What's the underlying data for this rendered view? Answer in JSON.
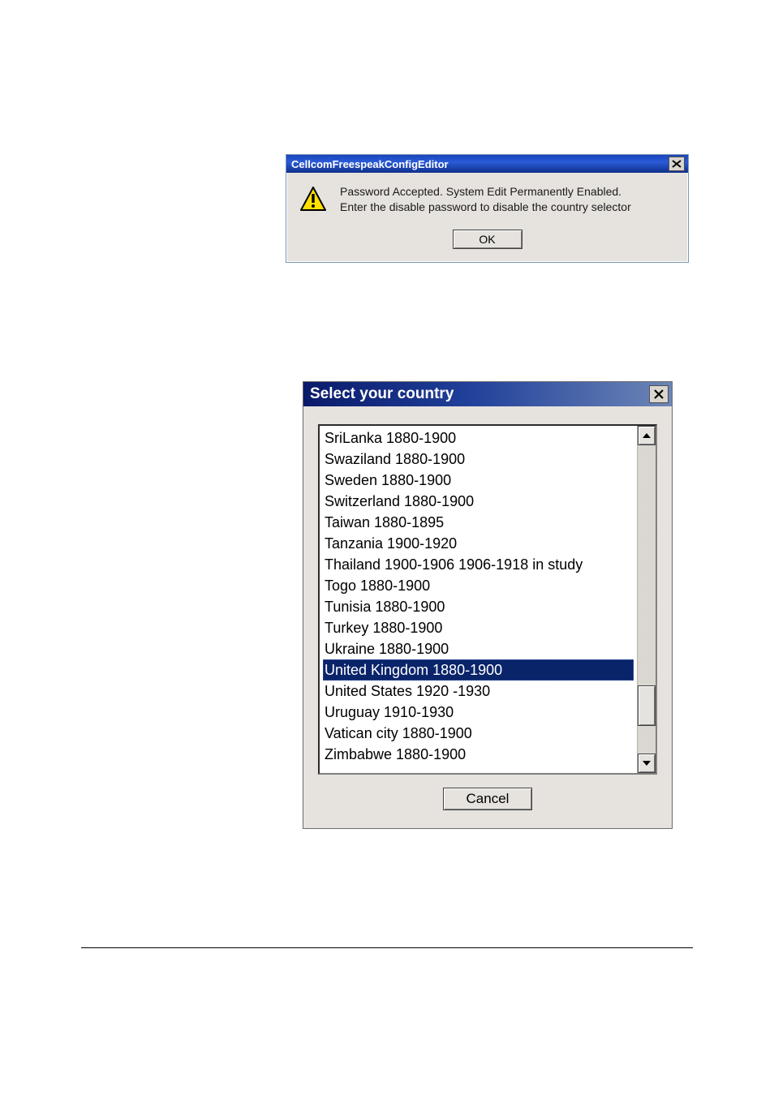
{
  "msg_dialog": {
    "title": "CellcomFreespeakConfigEditor",
    "line1": "Password Accepted. System Edit Permanently Enabled.",
    "line2": "Enter the disable password to disable the country selector",
    "ok_label": "OK"
  },
  "sel_dialog": {
    "title": "Select your country",
    "cancel_label": "Cancel",
    "selected_index": 11,
    "items": [
      "SriLanka 1880-1900",
      "Swaziland 1880-1900",
      "Sweden 1880-1900",
      "Switzerland 1880-1900",
      "Taiwan 1880-1895",
      "Tanzania 1900-1920",
      "Thailand 1900-1906 1906-1918 in study",
      "Togo 1880-1900",
      "Tunisia 1880-1900",
      "Turkey 1880-1900",
      "Ukraine 1880-1900",
      "United Kingdom 1880-1900",
      "United States 1920 -1930",
      "Uruguay 1910-1930",
      "Vatican city 1880-1900",
      "Zimbabwe 1880-1900"
    ]
  }
}
